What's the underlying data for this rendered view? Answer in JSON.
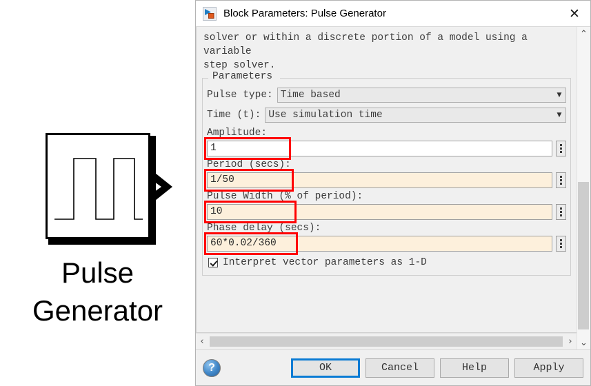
{
  "canvas": {
    "block": {
      "label": "Pulse\nGenerator",
      "icon_name": "pulse-waveform-icon",
      "port_name": "output-port-arrow"
    }
  },
  "dialog": {
    "title": "Block Parameters: Pulse Generator",
    "app_icon": "simulink-block-icon",
    "close_label": "✕",
    "description": "solver or within a discrete portion of a model using a variable\nstep solver.",
    "group": {
      "legend": "Parameters",
      "pulse_type": {
        "label": "Pulse type:",
        "value": "Time based",
        "arrow": "▼"
      },
      "time_t": {
        "label": "Time (t):",
        "value": "Use simulation time",
        "arrow": "▼"
      },
      "fields": [
        {
          "label": "Amplitude:",
          "value": "1",
          "modified": false,
          "highlighted": true
        },
        {
          "label": "Period (secs):",
          "value": "1/50",
          "modified": true,
          "highlighted": true
        },
        {
          "label": "Pulse Width (% of period):",
          "value": "10",
          "modified": true,
          "highlighted": true
        },
        {
          "label": "Phase delay (secs):",
          "value": "60*0.02/360",
          "modified": true,
          "highlighted": true
        }
      ],
      "checkbox": {
        "label": "Interpret vector parameters as 1-D",
        "checked": true
      }
    },
    "scrollbars": {
      "h_left_arrow": "‹",
      "h_right_arrow": "›",
      "v_up_arrow": "⌃",
      "v_down_arrow": "⌄"
    },
    "footer": {
      "help_glyph": "?",
      "buttons": [
        {
          "label": "OK",
          "focused": true
        },
        {
          "label": "Cancel",
          "focused": false
        },
        {
          "label": "Help",
          "focused": false
        },
        {
          "label": "Apply",
          "focused": false
        }
      ]
    }
  },
  "colors": {
    "highlight_red": "#ff0000",
    "modified_field": "#fdf0dc",
    "focus_blue": "#0a7bd4"
  }
}
